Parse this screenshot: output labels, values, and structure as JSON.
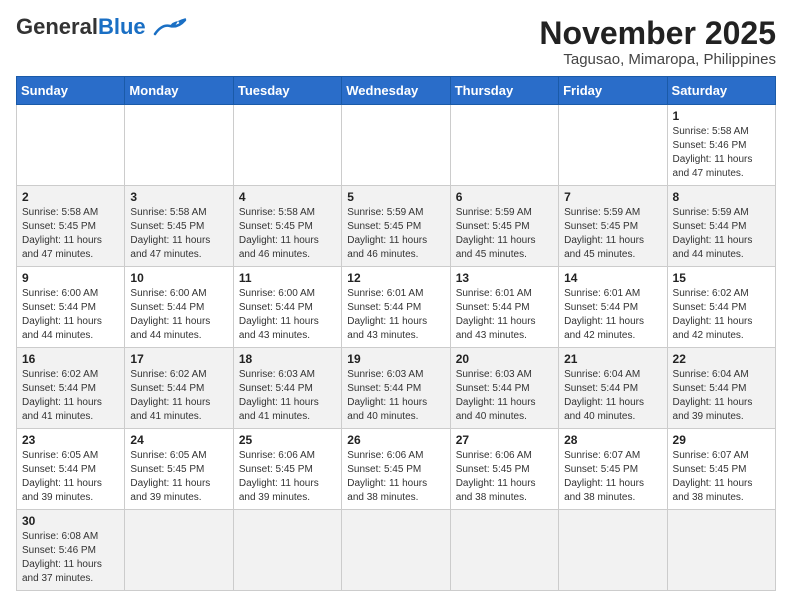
{
  "header": {
    "logo_general": "General",
    "logo_blue": "Blue",
    "month_title": "November 2025",
    "location": "Tagusao, Mimaropa, Philippines"
  },
  "weekdays": [
    "Sunday",
    "Monday",
    "Tuesday",
    "Wednesday",
    "Thursday",
    "Friday",
    "Saturday"
  ],
  "weeks": [
    [
      {
        "day": "",
        "content": ""
      },
      {
        "day": "",
        "content": ""
      },
      {
        "day": "",
        "content": ""
      },
      {
        "day": "",
        "content": ""
      },
      {
        "day": "",
        "content": ""
      },
      {
        "day": "",
        "content": ""
      },
      {
        "day": "1",
        "content": "Sunrise: 5:58 AM\nSunset: 5:46 PM\nDaylight: 11 hours and 47 minutes."
      }
    ],
    [
      {
        "day": "2",
        "content": "Sunrise: 5:58 AM\nSunset: 5:45 PM\nDaylight: 11 hours and 47 minutes."
      },
      {
        "day": "3",
        "content": "Sunrise: 5:58 AM\nSunset: 5:45 PM\nDaylight: 11 hours and 47 minutes."
      },
      {
        "day": "4",
        "content": "Sunrise: 5:58 AM\nSunset: 5:45 PM\nDaylight: 11 hours and 46 minutes."
      },
      {
        "day": "5",
        "content": "Sunrise: 5:59 AM\nSunset: 5:45 PM\nDaylight: 11 hours and 46 minutes."
      },
      {
        "day": "6",
        "content": "Sunrise: 5:59 AM\nSunset: 5:45 PM\nDaylight: 11 hours and 45 minutes."
      },
      {
        "day": "7",
        "content": "Sunrise: 5:59 AM\nSunset: 5:45 PM\nDaylight: 11 hours and 45 minutes."
      },
      {
        "day": "8",
        "content": "Sunrise: 5:59 AM\nSunset: 5:44 PM\nDaylight: 11 hours and 44 minutes."
      }
    ],
    [
      {
        "day": "9",
        "content": "Sunrise: 6:00 AM\nSunset: 5:44 PM\nDaylight: 11 hours and 44 minutes."
      },
      {
        "day": "10",
        "content": "Sunrise: 6:00 AM\nSunset: 5:44 PM\nDaylight: 11 hours and 44 minutes."
      },
      {
        "day": "11",
        "content": "Sunrise: 6:00 AM\nSunset: 5:44 PM\nDaylight: 11 hours and 43 minutes."
      },
      {
        "day": "12",
        "content": "Sunrise: 6:01 AM\nSunset: 5:44 PM\nDaylight: 11 hours and 43 minutes."
      },
      {
        "day": "13",
        "content": "Sunrise: 6:01 AM\nSunset: 5:44 PM\nDaylight: 11 hours and 43 minutes."
      },
      {
        "day": "14",
        "content": "Sunrise: 6:01 AM\nSunset: 5:44 PM\nDaylight: 11 hours and 42 minutes."
      },
      {
        "day": "15",
        "content": "Sunrise: 6:02 AM\nSunset: 5:44 PM\nDaylight: 11 hours and 42 minutes."
      }
    ],
    [
      {
        "day": "16",
        "content": "Sunrise: 6:02 AM\nSunset: 5:44 PM\nDaylight: 11 hours and 41 minutes."
      },
      {
        "day": "17",
        "content": "Sunrise: 6:02 AM\nSunset: 5:44 PM\nDaylight: 11 hours and 41 minutes."
      },
      {
        "day": "18",
        "content": "Sunrise: 6:03 AM\nSunset: 5:44 PM\nDaylight: 11 hours and 41 minutes."
      },
      {
        "day": "19",
        "content": "Sunrise: 6:03 AM\nSunset: 5:44 PM\nDaylight: 11 hours and 40 minutes."
      },
      {
        "day": "20",
        "content": "Sunrise: 6:03 AM\nSunset: 5:44 PM\nDaylight: 11 hours and 40 minutes."
      },
      {
        "day": "21",
        "content": "Sunrise: 6:04 AM\nSunset: 5:44 PM\nDaylight: 11 hours and 40 minutes."
      },
      {
        "day": "22",
        "content": "Sunrise: 6:04 AM\nSunset: 5:44 PM\nDaylight: 11 hours and 39 minutes."
      }
    ],
    [
      {
        "day": "23",
        "content": "Sunrise: 6:05 AM\nSunset: 5:44 PM\nDaylight: 11 hours and 39 minutes."
      },
      {
        "day": "24",
        "content": "Sunrise: 6:05 AM\nSunset: 5:45 PM\nDaylight: 11 hours and 39 minutes."
      },
      {
        "day": "25",
        "content": "Sunrise: 6:06 AM\nSunset: 5:45 PM\nDaylight: 11 hours and 39 minutes."
      },
      {
        "day": "26",
        "content": "Sunrise: 6:06 AM\nSunset: 5:45 PM\nDaylight: 11 hours and 38 minutes."
      },
      {
        "day": "27",
        "content": "Sunrise: 6:06 AM\nSunset: 5:45 PM\nDaylight: 11 hours and 38 minutes."
      },
      {
        "day": "28",
        "content": "Sunrise: 6:07 AM\nSunset: 5:45 PM\nDaylight: 11 hours and 38 minutes."
      },
      {
        "day": "29",
        "content": "Sunrise: 6:07 AM\nSunset: 5:45 PM\nDaylight: 11 hours and 38 minutes."
      }
    ],
    [
      {
        "day": "30",
        "content": "Sunrise: 6:08 AM\nSunset: 5:46 PM\nDaylight: 11 hours and 37 minutes."
      },
      {
        "day": "",
        "content": ""
      },
      {
        "day": "",
        "content": ""
      },
      {
        "day": "",
        "content": ""
      },
      {
        "day": "",
        "content": ""
      },
      {
        "day": "",
        "content": ""
      },
      {
        "day": "",
        "content": ""
      }
    ]
  ]
}
